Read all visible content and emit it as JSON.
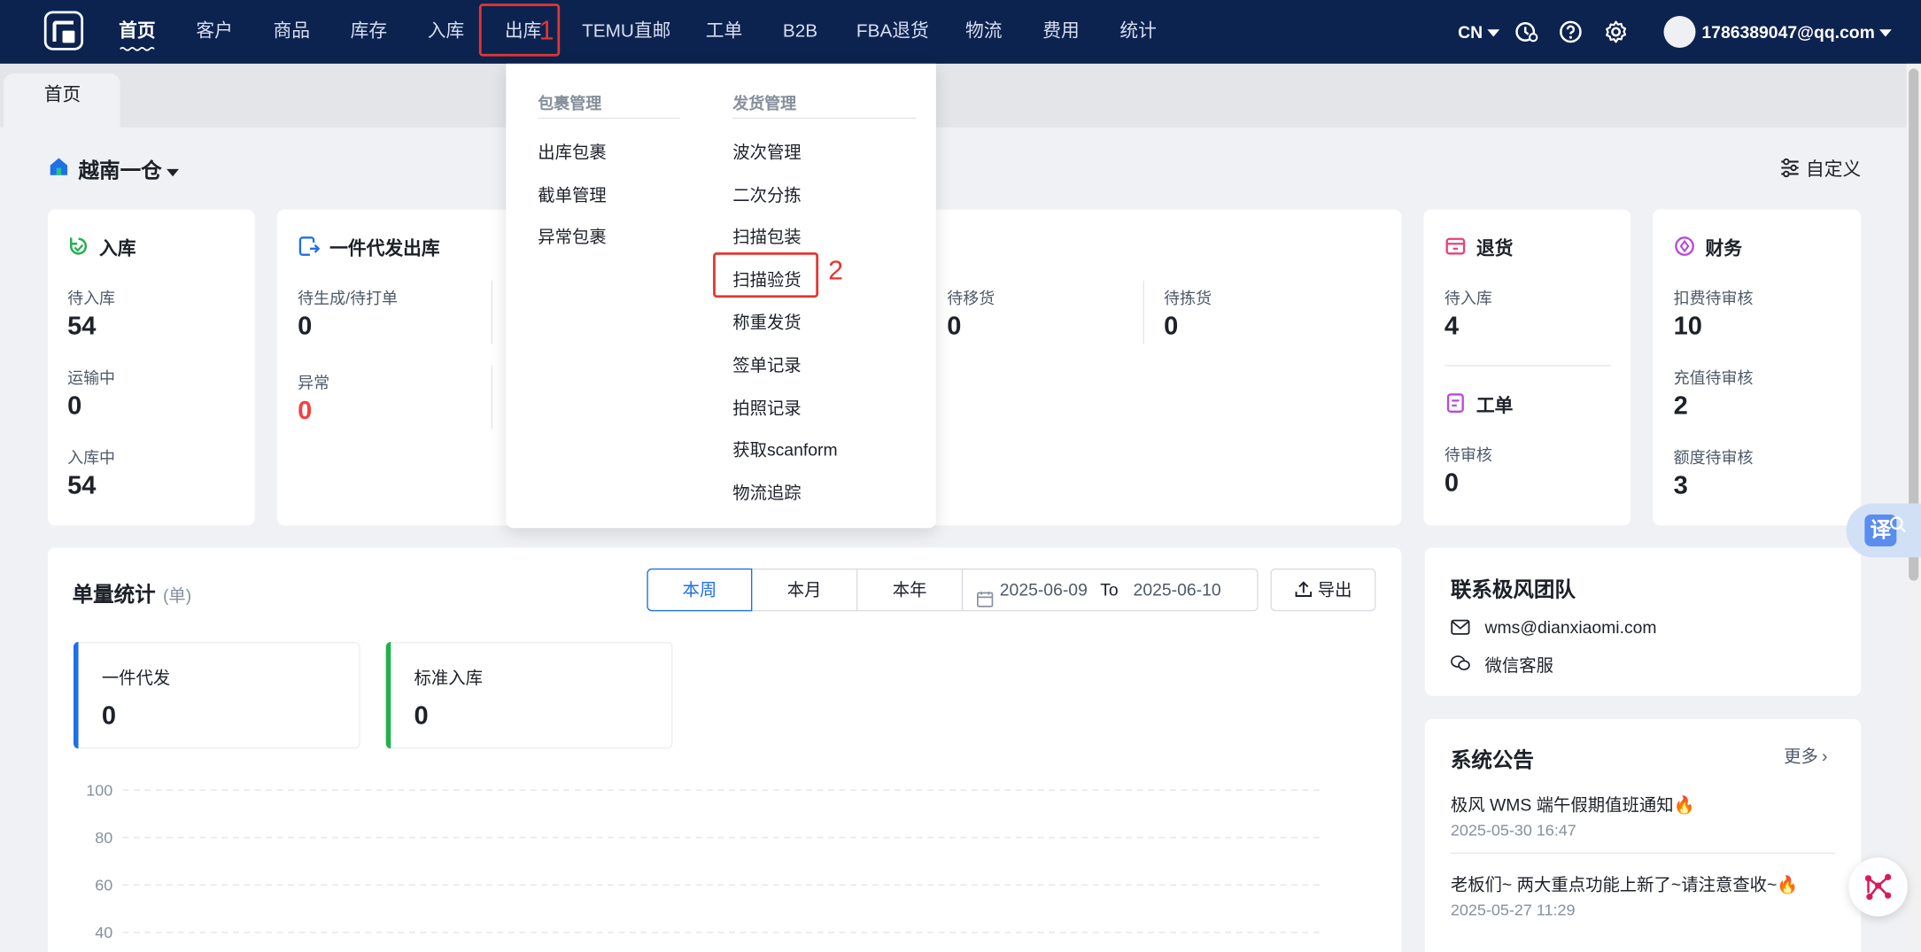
{
  "nav": {
    "items": [
      "首页",
      "客户",
      "商品",
      "库存",
      "入库",
      "出库",
      "TEMU直邮",
      "工单",
      "B2B",
      "FBA退货",
      "物流",
      "费用",
      "统计"
    ],
    "language": "CN",
    "user": "1786389047@qq.com"
  },
  "annotations": {
    "step1": "1",
    "step2": "2",
    "color": "#e5352f"
  },
  "tabs": {
    "home": "首页"
  },
  "warehouse": {
    "name": "越南一仓",
    "customize": "自定义"
  },
  "cards": {
    "inbound": {
      "title": "入库",
      "stats": [
        {
          "label": "待入库",
          "value": "54"
        },
        {
          "label": "运输中",
          "value": "0"
        },
        {
          "label": "入库中",
          "value": "54"
        }
      ]
    },
    "dropship": {
      "title": "一件代发出库",
      "stats": [
        {
          "label": "待生成/待打单",
          "value": "0"
        },
        {
          "label": "异常",
          "value": "0"
        },
        {
          "label": "待移货",
          "value": "0"
        },
        {
          "label": "待拣货",
          "value": "0"
        }
      ]
    },
    "returns": {
      "title": "退货",
      "stats": [
        {
          "label": "待入库",
          "value": "4"
        }
      ]
    },
    "workorder": {
      "title": "工单",
      "stats": [
        {
          "label": "待审核",
          "value": "0"
        }
      ]
    },
    "finance": {
      "title": "财务",
      "stats": [
        {
          "label": "扣费待审核",
          "value": "10"
        },
        {
          "label": "充值待审核",
          "value": "2"
        },
        {
          "label": "额度待审核",
          "value": "3"
        }
      ]
    }
  },
  "dropdown": {
    "groups": [
      {
        "title": "包裹管理",
        "items": [
          "出库包裹",
          "截单管理",
          "异常包裹"
        ]
      },
      {
        "title": "发货管理",
        "items": [
          "波次管理",
          "二次分拣",
          "扫描包装",
          "扫描验货",
          "称重发货",
          "签单记录",
          "拍照记录",
          "获取scanform",
          "物流追踪"
        ]
      }
    ]
  },
  "stats": {
    "title": "单量统计",
    "unit": "(单)",
    "periods": [
      "本周",
      "本月",
      "本年"
    ],
    "date_from": "2025-06-09",
    "date_sep": "To",
    "date_to": "2025-06-10",
    "export": "导出",
    "summary": [
      {
        "label": "一件代发",
        "value": "0",
        "color": "#1f6fe8"
      },
      {
        "label": "标准入库",
        "value": "0",
        "color": "#22b14c"
      }
    ]
  },
  "chart_data": {
    "type": "line",
    "y_ticks": [
      100,
      80,
      60,
      40
    ],
    "series": []
  },
  "contact": {
    "title": "联系极风团队",
    "email": "wms@dianxiaomi.com",
    "wechat": "微信客服"
  },
  "notices": {
    "title": "系统公告",
    "more": "更多",
    "items": [
      {
        "title": "极风 WMS 端午假期值班通知",
        "date": "2025-05-30 16:47"
      },
      {
        "title": "老板们~ 两大重点功能上新了~请注意查收~",
        "date": "2025-05-27 11:29"
      }
    ]
  },
  "translate_button": "译"
}
